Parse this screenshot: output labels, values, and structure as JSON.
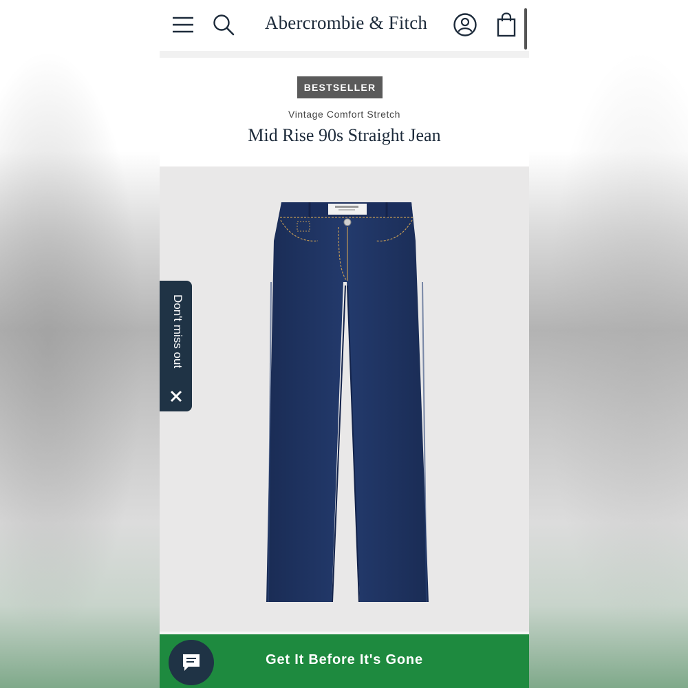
{
  "header": {
    "brand": "Abercrombie & Fitch",
    "icons": [
      "menu-icon",
      "search-icon",
      "account-icon",
      "bag-icon"
    ]
  },
  "product": {
    "badge": "BESTSELLER",
    "collection": "Vintage Comfort Stretch",
    "name": "Mid Rise 90s Straight Jean"
  },
  "promo_tab": {
    "label": "Don't miss out"
  },
  "cta": {
    "label": "Get It Before It's Gone"
  },
  "colors": {
    "cta_green": "#1e8a3f",
    "navy": "#1f3345",
    "badge_gray": "#5a5a5a",
    "denim": "#1d3360"
  }
}
